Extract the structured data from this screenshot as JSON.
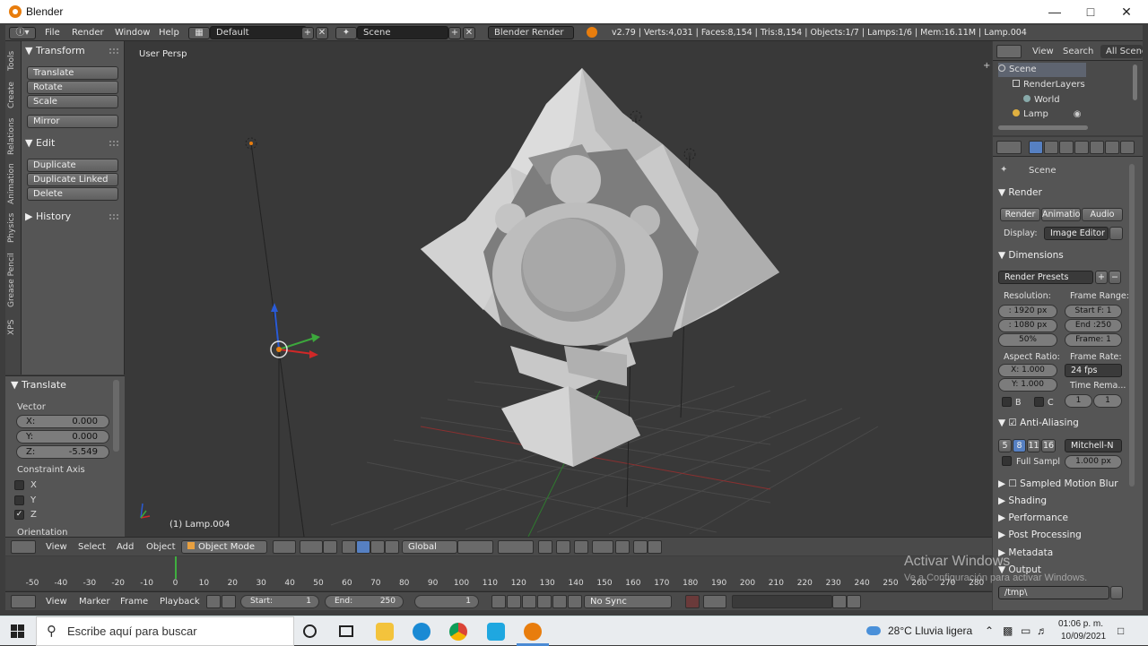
{
  "window": {
    "title": "Blender"
  },
  "menubar": {
    "file": "File",
    "render": "Render",
    "window": "Window",
    "help": "Help",
    "layout": "Default",
    "scene": "Scene",
    "engine": "Blender Render",
    "stats": "v2.79 | Verts:4,031 | Faces:8,154 | Tris:8,154 | Objects:1/7 | Lamps:1/6 | Mem:16.11M | Lamp.004"
  },
  "tool_tabs": [
    "Tools",
    "Create",
    "Relations",
    "Animation",
    "Physics",
    "Grease Pencil",
    "XPS"
  ],
  "toolshelf": {
    "transform_header": "Transform",
    "translate": "Translate",
    "rotate": "Rotate",
    "scale": "Scale",
    "mirror": "Mirror",
    "edit_header": "Edit",
    "duplicate": "Duplicate",
    "duplicate_linked": "Duplicate Linked",
    "delete": "Delete",
    "history_header": "History"
  },
  "operator_panel": {
    "header": "Translate",
    "vector_label": "Vector",
    "x_key": "X:",
    "x": "0.000",
    "y_key": "Y:",
    "y": "0.000",
    "z_key": "Z:",
    "z": "-5.549",
    "constraint_label": "Constraint Axis",
    "axis_x": "X",
    "axis_y": "Y",
    "axis_z": "Z",
    "orientation_label": "Orientation"
  },
  "viewport": {
    "view_name": "User Persp",
    "active_object": "(1) Lamp.004"
  },
  "view3d_header": {
    "view": "View",
    "select": "Select",
    "add": "Add",
    "object": "Object",
    "mode": "Object Mode",
    "orientation": "Global"
  },
  "timeline": {
    "ticks": [
      "-50",
      "-40",
      "-30",
      "-20",
      "-10",
      "0",
      "10",
      "20",
      "30",
      "40",
      "50",
      "60",
      "70",
      "80",
      "90",
      "100",
      "110",
      "120",
      "130",
      "140",
      "150",
      "160",
      "170",
      "180",
      "190",
      "200",
      "210",
      "220",
      "230",
      "240",
      "250",
      "260",
      "270",
      "280"
    ],
    "current_frame_pct": 0.22
  },
  "timeline_header": {
    "view": "View",
    "marker": "Marker",
    "frame": "Frame",
    "playback": "Playback",
    "start_label": "Start:",
    "start": "1",
    "end_label": "End:",
    "end": "250",
    "current": "1",
    "sync": "No Sync"
  },
  "outliner": {
    "view": "View",
    "search": "Search",
    "filter": "All Scenes",
    "items": [
      "Scene",
      "RenderLayers",
      "World",
      "Lamp"
    ]
  },
  "properties": {
    "context": "Scene",
    "render_header": "Render",
    "render_btn": "Render",
    "anim_btn": "Animation",
    "audio_btn": "Audio",
    "display_label": "Display:",
    "display_value": "Image Editor",
    "dimensions_header": "Dimensions",
    "presets": "Render Presets",
    "resolution_label": "Resolution:",
    "frame_range_label": "Frame Range:",
    "res_x": ": 1920 px",
    "res_y": ": 1080 px",
    "res_pct": "50%",
    "frame_start": "Start F: 1",
    "frame_end": "End :250",
    "frame_step": "Frame: 1",
    "aspect_label": "Aspect Ratio:",
    "framerate_label": "Frame Rate:",
    "aspect_x": "X:  1.000",
    "aspect_y": "Y:  1.000",
    "fps": "24 fps",
    "time_remap_label": "Time Rema...",
    "remap_a": "1",
    "remap_b": "1",
    "border_b": "B",
    "border_c": "C",
    "aa_header": "Anti-Aliasing",
    "aa_5": "5",
    "aa_8": "8",
    "aa_11": "11",
    "aa_16": "16",
    "aa_filter": "Mitchell-N",
    "full_sample": "Full Sampl",
    "filter_size": "1.000 px",
    "motion_blur": "Sampled Motion Blur",
    "shading": "Shading",
    "performance": "Performance",
    "post_processing": "Post Processing",
    "metadata": "Metadata",
    "output": "Output",
    "output_path": "/tmp\\"
  },
  "watermark": {
    "line1": "Activar Windows",
    "line2": "Ve a Configuración para activar Windows."
  },
  "taskbar": {
    "search_placeholder": "Escribe aquí para buscar",
    "weather": "28°C  Lluvia ligera",
    "time": "01:06 p. m.",
    "date": "10/09/2021"
  },
  "colors": {
    "blender_orange": "#e87d0d",
    "selected_blue": "#5680c2",
    "frame_green": "#3fae3f"
  }
}
